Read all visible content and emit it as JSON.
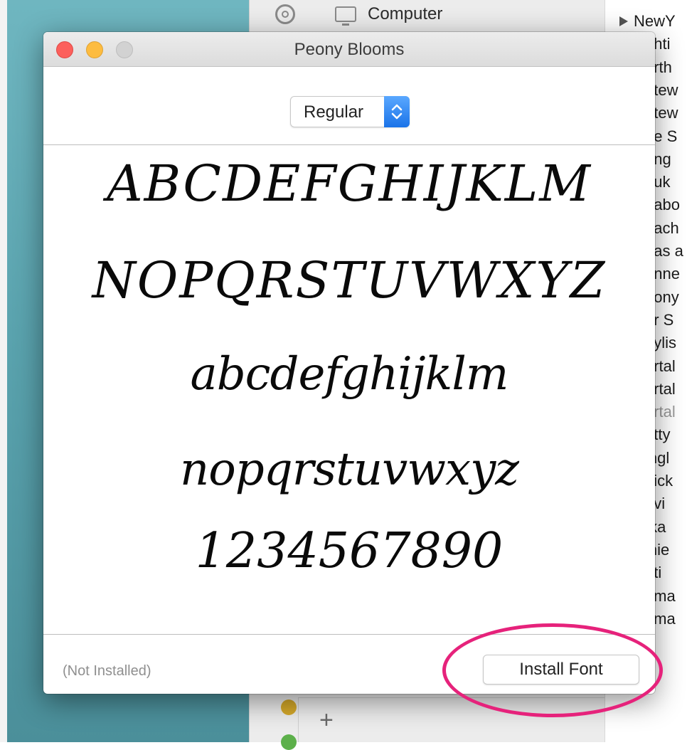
{
  "finder": {
    "sidebar_computer_label": "Computer"
  },
  "font_list": {
    "items": [
      {
        "label": "NewY",
        "disclosure": true
      },
      {
        "label": "ghti",
        "disclosure": false
      },
      {
        "label": "orth",
        "disclosure": false
      },
      {
        "label": "otew",
        "disclosure": false
      },
      {
        "label": "otew",
        "disclosure": false
      },
      {
        "label": "ne S",
        "disclosure": false
      },
      {
        "label": "ang",
        "disclosure": false
      },
      {
        "label": "duk",
        "disclosure": false
      },
      {
        "label": "eabo",
        "disclosure": false
      },
      {
        "label": "each",
        "disclosure": false
      },
      {
        "label": "eas a",
        "disclosure": false
      },
      {
        "label": "enne",
        "disclosure": false
      },
      {
        "label": "eony",
        "disclosure": false
      },
      {
        "label": "er S",
        "disclosure": false
      },
      {
        "label": "aylis",
        "disclosure": false
      },
      {
        "label": "ortal",
        "disclosure": false
      },
      {
        "label": "ortal",
        "disclosure": false
      },
      {
        "label": "ortal",
        "disclosure": false,
        "dim": true
      },
      {
        "label": "etty",
        "disclosure": false
      },
      {
        "label": "ingl",
        "disclosure": false
      },
      {
        "label": "uick",
        "disclosure": false
      },
      {
        "label": "avi",
        "disclosure": false
      },
      {
        "label": "fka",
        "disclosure": false
      },
      {
        "label": "inie",
        "disclosure": false
      },
      {
        "label": "ati",
        "disclosure": false
      },
      {
        "label": "Roma",
        "disclosure": true
      },
      {
        "label": "Roma",
        "disclosure": true
      }
    ]
  },
  "preview_window": {
    "title": "Peony Blooms",
    "style_select": {
      "value": "Regular"
    },
    "samples": {
      "uppercase_1": "ABCDEFGHIJKLM",
      "uppercase_2": "NOPQRSTUVWXYZ",
      "lowercase_1": "abcdefghijklm",
      "lowercase_2": "nopqrstuvwxyz",
      "digits": "1234567890"
    },
    "status": "(Not Installed)",
    "install_button": "Install Font"
  },
  "colors": {
    "highlight": "#e6227b",
    "close": "#fc605c",
    "minimize": "#fdbc40",
    "accent_stepper": "#1a73e8"
  }
}
